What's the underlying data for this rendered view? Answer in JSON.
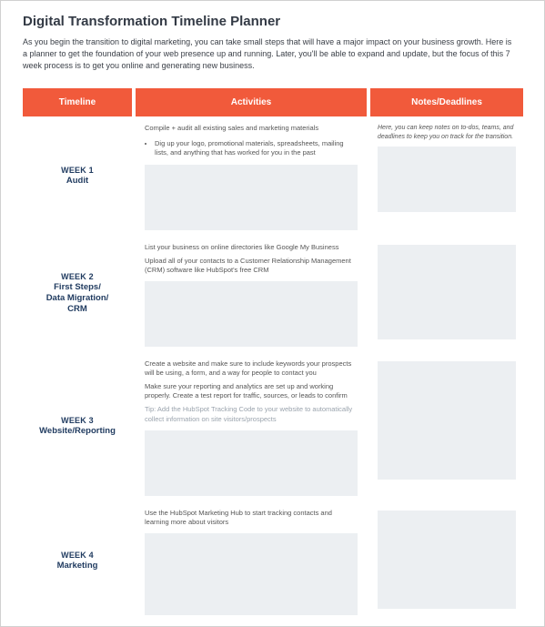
{
  "title": "Digital Transformation Timeline Planner",
  "intro": "As you begin the transition to digital marketing, you can take small steps that will have a major impact on your business growth. Here is a planner to get the foundation of your web presence up and running. Later, you'll be able to expand and update, but the focus of this 7 week process is to get you online and generating new business.",
  "headers": {
    "timeline": "Timeline",
    "activities": "Activities",
    "notes": "Notes/Deadlines"
  },
  "notes_hint": "Here, you can keep notes on to-dos, teams, and deadlines to keep you on track for the transition.",
  "weeks": [
    {
      "num": "WEEK 1",
      "name": "Audit",
      "act_lead": "Compile + audit all existing sales and marketing materials",
      "bullet": "Dig up your logo, promotional materials, spreadsheets, mailing lists, and anything that has worked for you in the past"
    },
    {
      "num": "WEEK 2",
      "name": "First Steps/\nData Migration/\nCRM",
      "act_p1": "List your business on online directories like Google My Business",
      "act_p2": "Upload all of your contacts to a Customer Relationship Management (CRM) software like HubSpot's free CRM"
    },
    {
      "num": "WEEK 3",
      "name": "Website/Reporting",
      "act_p1": "Create a website and make sure to include keywords your prospects will be using, a form, and a way for people to contact you",
      "act_p2": "Make sure your reporting and analytics are set up and working properly. Create a test report for traffic, sources, or leads to confirm",
      "tip": "Tip: Add the HubSpot Tracking Code to your website to automatically collect information on site visitors/prospects"
    },
    {
      "num": "WEEK 4",
      "name": "Marketing",
      "act_p1": "Use the HubSpot Marketing Hub to start tracking contacts and learning more about visitors"
    }
  ]
}
